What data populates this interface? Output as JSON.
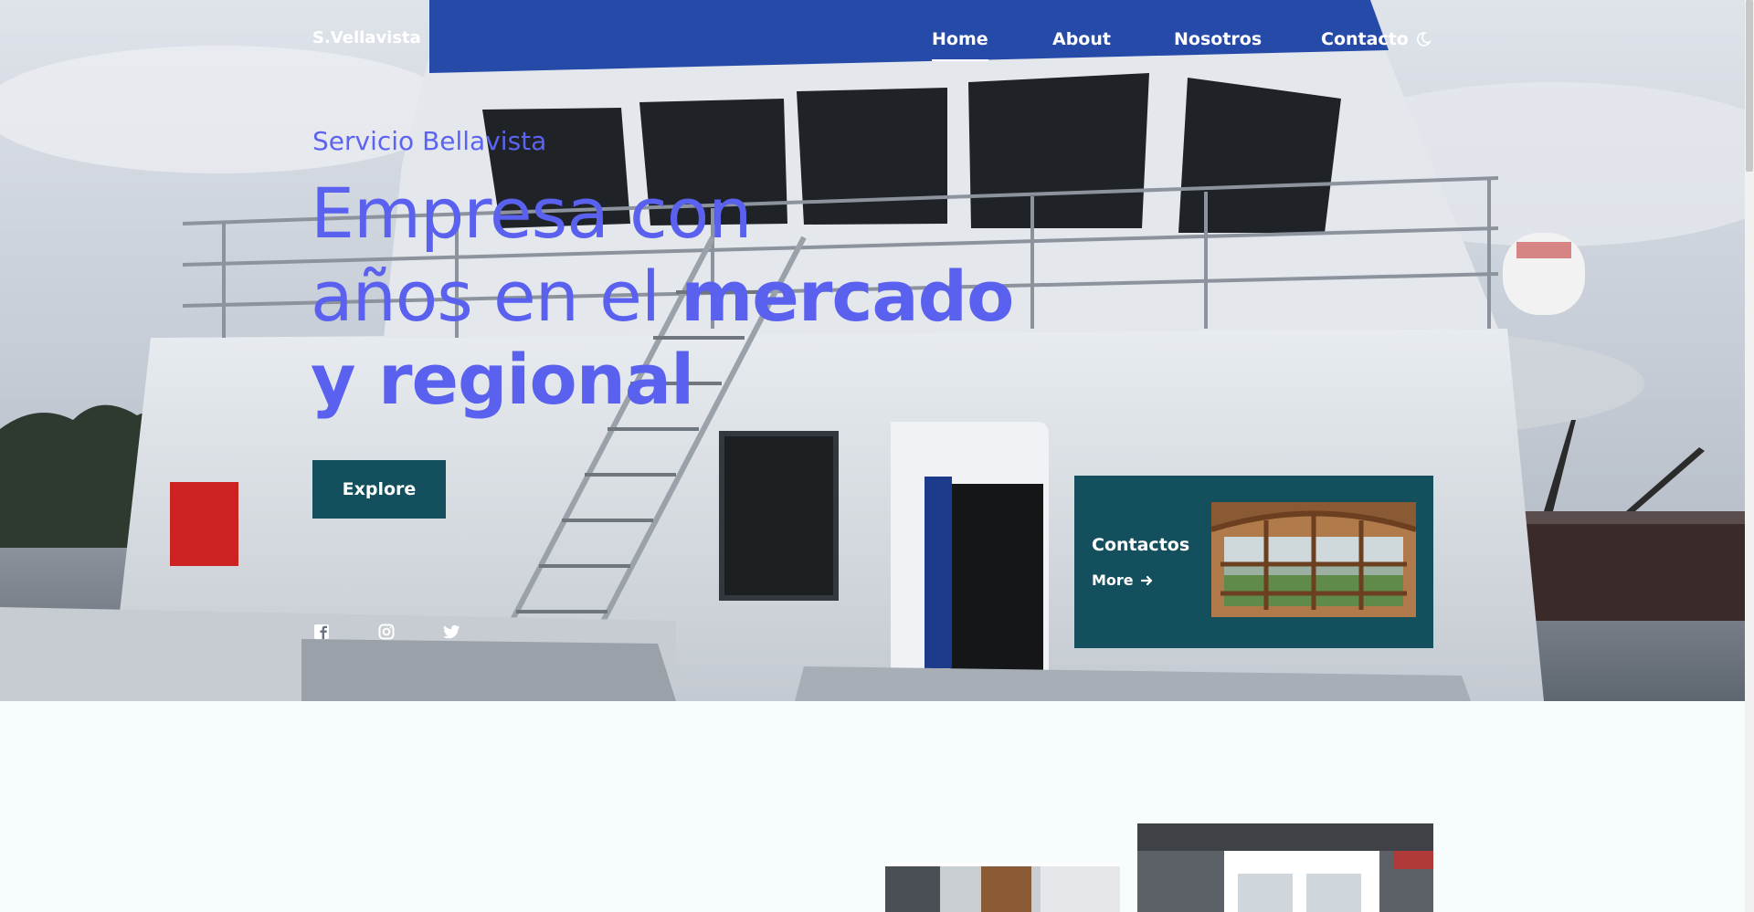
{
  "brand": "S.Vellavista",
  "nav": {
    "items": [
      {
        "label": "Home",
        "active": true
      },
      {
        "label": "About",
        "active": false
      },
      {
        "label": "Nosotros",
        "active": false
      },
      {
        "label": "Contacto",
        "active": false
      }
    ],
    "theme_toggle_icon": "moon-icon"
  },
  "hero": {
    "eyebrow": "Servicio Bellavista",
    "headline_line1": "Empresa con",
    "headline_line2_light": "años en el ",
    "headline_line2_bold": "mercado",
    "headline_line3": "y regional",
    "cta_label": "Explore",
    "background_image": "ship-bridge-photo",
    "accent_color": "#5a61ee"
  },
  "socials": [
    {
      "name": "facebook-icon"
    },
    {
      "name": "instagram-icon"
    },
    {
      "name": "twitter-icon"
    }
  ],
  "contact_card": {
    "title": "Contactos",
    "more_label": "More",
    "more_icon": "arrow-right-icon",
    "image": "wooden-window-photo",
    "background_color": "#134f5c"
  }
}
